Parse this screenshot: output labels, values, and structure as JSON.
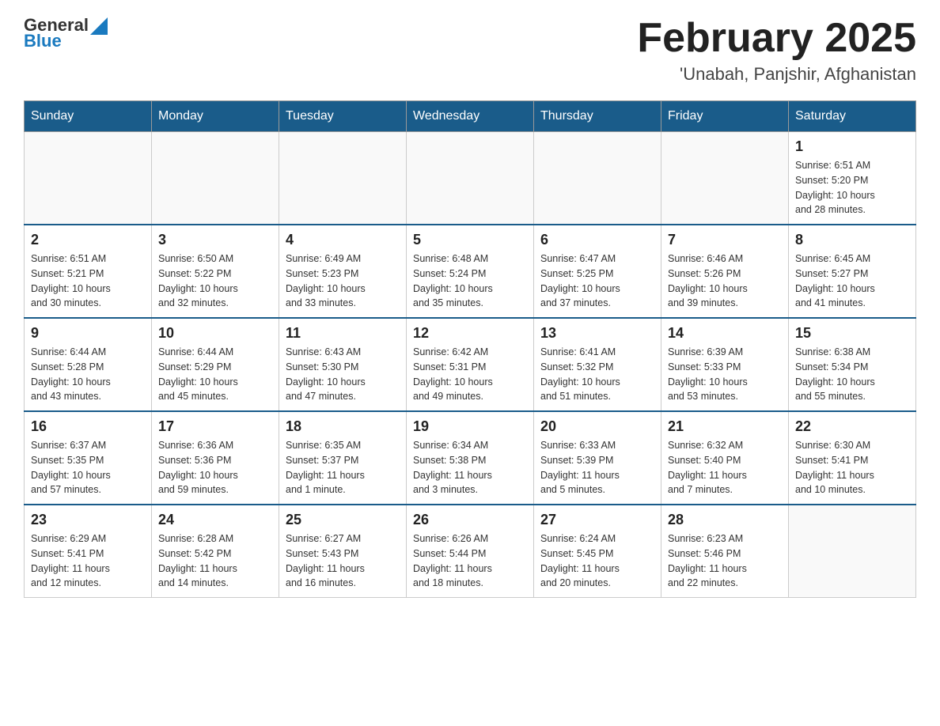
{
  "header": {
    "logo_general": "General",
    "logo_blue": "Blue",
    "month_title": "February 2025",
    "location": "'Unabah, Panjshir, Afghanistan"
  },
  "weekdays": [
    "Sunday",
    "Monday",
    "Tuesday",
    "Wednesday",
    "Thursday",
    "Friday",
    "Saturday"
  ],
  "weeks": [
    [
      {
        "day": "",
        "info": ""
      },
      {
        "day": "",
        "info": ""
      },
      {
        "day": "",
        "info": ""
      },
      {
        "day": "",
        "info": ""
      },
      {
        "day": "",
        "info": ""
      },
      {
        "day": "",
        "info": ""
      },
      {
        "day": "1",
        "info": "Sunrise: 6:51 AM\nSunset: 5:20 PM\nDaylight: 10 hours\nand 28 minutes."
      }
    ],
    [
      {
        "day": "2",
        "info": "Sunrise: 6:51 AM\nSunset: 5:21 PM\nDaylight: 10 hours\nand 30 minutes."
      },
      {
        "day": "3",
        "info": "Sunrise: 6:50 AM\nSunset: 5:22 PM\nDaylight: 10 hours\nand 32 minutes."
      },
      {
        "day": "4",
        "info": "Sunrise: 6:49 AM\nSunset: 5:23 PM\nDaylight: 10 hours\nand 33 minutes."
      },
      {
        "day": "5",
        "info": "Sunrise: 6:48 AM\nSunset: 5:24 PM\nDaylight: 10 hours\nand 35 minutes."
      },
      {
        "day": "6",
        "info": "Sunrise: 6:47 AM\nSunset: 5:25 PM\nDaylight: 10 hours\nand 37 minutes."
      },
      {
        "day": "7",
        "info": "Sunrise: 6:46 AM\nSunset: 5:26 PM\nDaylight: 10 hours\nand 39 minutes."
      },
      {
        "day": "8",
        "info": "Sunrise: 6:45 AM\nSunset: 5:27 PM\nDaylight: 10 hours\nand 41 minutes."
      }
    ],
    [
      {
        "day": "9",
        "info": "Sunrise: 6:44 AM\nSunset: 5:28 PM\nDaylight: 10 hours\nand 43 minutes."
      },
      {
        "day": "10",
        "info": "Sunrise: 6:44 AM\nSunset: 5:29 PM\nDaylight: 10 hours\nand 45 minutes."
      },
      {
        "day": "11",
        "info": "Sunrise: 6:43 AM\nSunset: 5:30 PM\nDaylight: 10 hours\nand 47 minutes."
      },
      {
        "day": "12",
        "info": "Sunrise: 6:42 AM\nSunset: 5:31 PM\nDaylight: 10 hours\nand 49 minutes."
      },
      {
        "day": "13",
        "info": "Sunrise: 6:41 AM\nSunset: 5:32 PM\nDaylight: 10 hours\nand 51 minutes."
      },
      {
        "day": "14",
        "info": "Sunrise: 6:39 AM\nSunset: 5:33 PM\nDaylight: 10 hours\nand 53 minutes."
      },
      {
        "day": "15",
        "info": "Sunrise: 6:38 AM\nSunset: 5:34 PM\nDaylight: 10 hours\nand 55 minutes."
      }
    ],
    [
      {
        "day": "16",
        "info": "Sunrise: 6:37 AM\nSunset: 5:35 PM\nDaylight: 10 hours\nand 57 minutes."
      },
      {
        "day": "17",
        "info": "Sunrise: 6:36 AM\nSunset: 5:36 PM\nDaylight: 10 hours\nand 59 minutes."
      },
      {
        "day": "18",
        "info": "Sunrise: 6:35 AM\nSunset: 5:37 PM\nDaylight: 11 hours\nand 1 minute."
      },
      {
        "day": "19",
        "info": "Sunrise: 6:34 AM\nSunset: 5:38 PM\nDaylight: 11 hours\nand 3 minutes."
      },
      {
        "day": "20",
        "info": "Sunrise: 6:33 AM\nSunset: 5:39 PM\nDaylight: 11 hours\nand 5 minutes."
      },
      {
        "day": "21",
        "info": "Sunrise: 6:32 AM\nSunset: 5:40 PM\nDaylight: 11 hours\nand 7 minutes."
      },
      {
        "day": "22",
        "info": "Sunrise: 6:30 AM\nSunset: 5:41 PM\nDaylight: 11 hours\nand 10 minutes."
      }
    ],
    [
      {
        "day": "23",
        "info": "Sunrise: 6:29 AM\nSunset: 5:41 PM\nDaylight: 11 hours\nand 12 minutes."
      },
      {
        "day": "24",
        "info": "Sunrise: 6:28 AM\nSunset: 5:42 PM\nDaylight: 11 hours\nand 14 minutes."
      },
      {
        "day": "25",
        "info": "Sunrise: 6:27 AM\nSunset: 5:43 PM\nDaylight: 11 hours\nand 16 minutes."
      },
      {
        "day": "26",
        "info": "Sunrise: 6:26 AM\nSunset: 5:44 PM\nDaylight: 11 hours\nand 18 minutes."
      },
      {
        "day": "27",
        "info": "Sunrise: 6:24 AM\nSunset: 5:45 PM\nDaylight: 11 hours\nand 20 minutes."
      },
      {
        "day": "28",
        "info": "Sunrise: 6:23 AM\nSunset: 5:46 PM\nDaylight: 11 hours\nand 22 minutes."
      },
      {
        "day": "",
        "info": ""
      }
    ]
  ]
}
